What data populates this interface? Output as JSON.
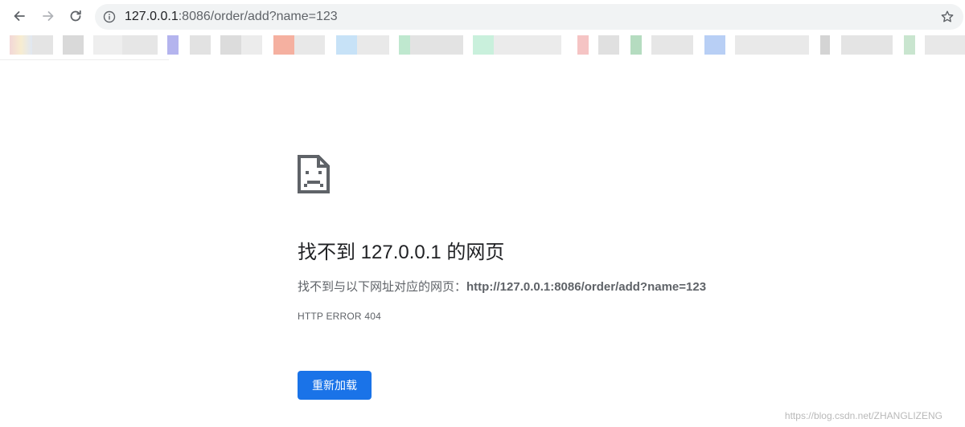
{
  "toolbar": {
    "back_icon": "arrow-left-icon",
    "forward_icon": "arrow-right-icon",
    "reload_icon": "reload-icon",
    "info_icon": "info-icon",
    "star_icon": "star-icon",
    "url_host": "127.0.0.1",
    "url_rest": ":8086/order/add?name=123"
  },
  "error_page": {
    "icon": "sad-page-icon",
    "title": "找不到 127.0.0.1 的网页",
    "description_prefix": "找不到与以下网址对应的网页：",
    "description_url": "http://127.0.0.1:8086/order/add?name=123",
    "error_code": "HTTP ERROR 404",
    "reload_label": "重新加载"
  },
  "watermark": "https://blog.csdn.net/ZHANGLIZENG",
  "colors": {
    "accent": "#1a73e8",
    "text_primary": "#202124",
    "text_secondary": "#5f6368",
    "omnibox_bg": "#f1f3f4"
  }
}
